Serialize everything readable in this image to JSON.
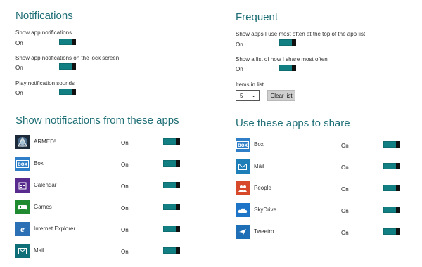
{
  "notifications": {
    "title": "Notifications",
    "settings": [
      {
        "label": "Show app notifications",
        "state": "On"
      },
      {
        "label": "Show app notifications on the lock screen",
        "state": "On"
      },
      {
        "label": "Play notification sounds",
        "state": "On"
      }
    ]
  },
  "show_apps": {
    "title": "Show notifications from these apps",
    "apps": [
      {
        "name": "ARMED!",
        "state": "On",
        "icon": "armed-app-icon",
        "color": "#1c2a3a"
      },
      {
        "name": "Box",
        "state": "On",
        "icon": "box-app-icon",
        "color": "#2f7fc8"
      },
      {
        "name": "Calendar",
        "state": "On",
        "icon": "calendar-app-icon",
        "color": "#5a2b8f"
      },
      {
        "name": "Games",
        "state": "On",
        "icon": "games-app-icon",
        "color": "#1f8a2f"
      },
      {
        "name": "Internet Explorer",
        "state": "On",
        "icon": "internet-explorer-app-icon",
        "color": "#2b6fb5"
      },
      {
        "name": "Mail",
        "state": "On",
        "icon": "mail-app-icon",
        "color": "#0f6f78"
      }
    ]
  },
  "frequent": {
    "title": "Frequent",
    "settings": [
      {
        "label": "Show apps I use most often at the top of the app list",
        "state": "On"
      },
      {
        "label": "Show a list of how I share most often",
        "state": "On"
      }
    ],
    "items_label": "Items in list",
    "items_value": "5",
    "clear_label": "Clear list"
  },
  "share_apps": {
    "title": "Use these apps to share",
    "apps": [
      {
        "name": "Box",
        "state": "On",
        "icon": "box-app-icon",
        "color": "#2f7fc8"
      },
      {
        "name": "Mail",
        "state": "On",
        "icon": "mail-app-icon",
        "color": "#1e7fb8"
      },
      {
        "name": "People",
        "state": "On",
        "icon": "people-app-icon",
        "color": "#d6492a"
      },
      {
        "name": "SkyDrive",
        "state": "On",
        "icon": "skydrive-app-icon",
        "color": "#1e74c6"
      },
      {
        "name": "Tweetro",
        "state": "On",
        "icon": "tweetro-app-icon",
        "color": "#1f6fb7"
      }
    ]
  },
  "colors": {
    "accent": "#1f6f76",
    "toggle_on": "#128082"
  }
}
